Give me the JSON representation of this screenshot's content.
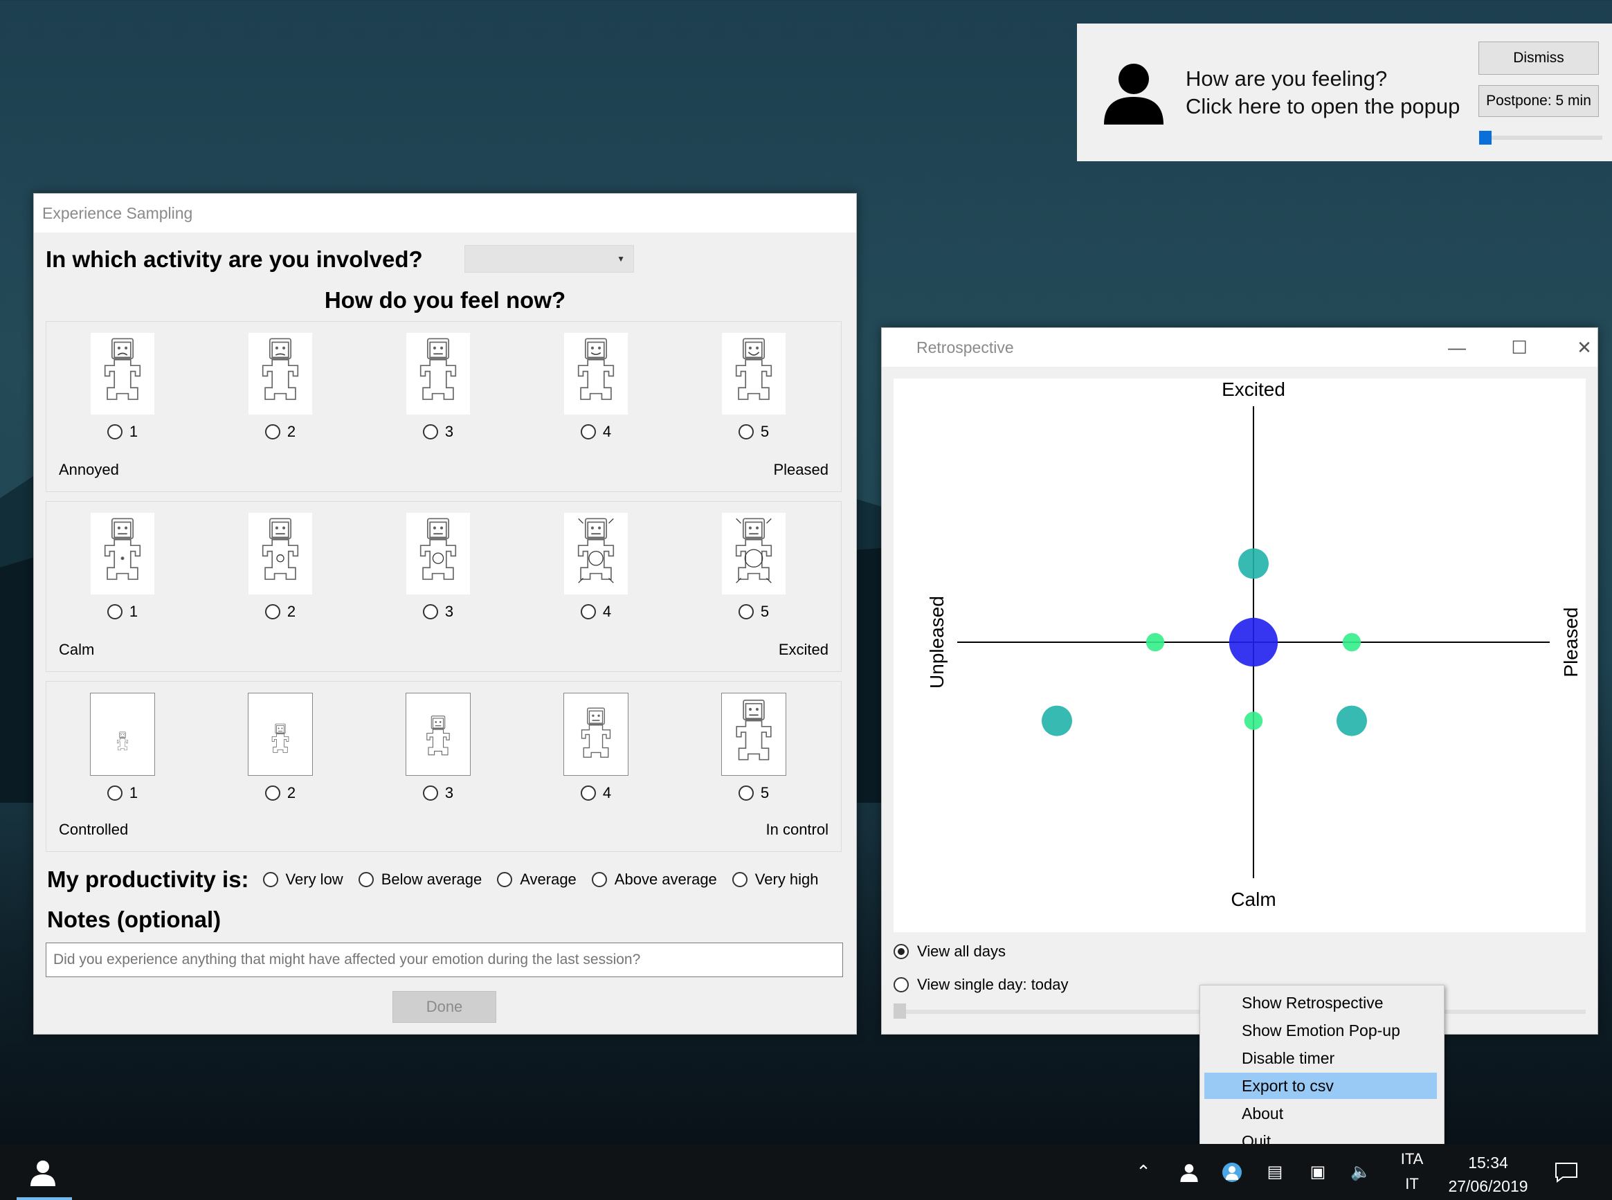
{
  "colors": {
    "accent": "#0a6fd8",
    "menu_highlight": "#99c9f5",
    "point_teal": "#20b2aa",
    "point_green": "#33ee88",
    "point_blue": "#2020ee"
  },
  "experience_window": {
    "title": "Experience Sampling",
    "activity_question": "In which activity are you involved?",
    "activity_value": "",
    "feel_question": "How do you feel now?",
    "scales": [
      {
        "options": [
          "1",
          "2",
          "3",
          "4",
          "5"
        ],
        "low": "Annoyed",
        "high": "Pleased",
        "icons": [
          "valence-1-icon",
          "valence-2-icon",
          "valence-3-icon",
          "valence-4-icon",
          "valence-5-icon"
        ]
      },
      {
        "options": [
          "1",
          "2",
          "3",
          "4",
          "5"
        ],
        "low": "Calm",
        "high": "Excited",
        "icons": [
          "arousal-1-icon",
          "arousal-2-icon",
          "arousal-3-icon",
          "arousal-4-icon",
          "arousal-5-icon"
        ]
      },
      {
        "options": [
          "1",
          "2",
          "3",
          "4",
          "5"
        ],
        "low": "Controlled",
        "high": "In control",
        "icons": [
          "dominance-1-icon",
          "dominance-2-icon",
          "dominance-3-icon",
          "dominance-4-icon",
          "dominance-5-icon"
        ]
      }
    ],
    "productivity_label": "My productivity is:",
    "productivity_options": [
      "Very low",
      "Below average",
      "Average",
      "Above average",
      "Very high"
    ],
    "notes_label": "Notes (optional)",
    "notes_placeholder": "Did you experience anything that might have affected your emotion during the last session?",
    "done_label": "Done"
  },
  "notification": {
    "line1": "How are you feeling?",
    "line2": "Click here to open the popup",
    "dismiss_label": "Dismiss",
    "postpone_label": "Postpone: 5 min",
    "icon": "user-icon"
  },
  "retrospective_window": {
    "title": "Retrospective",
    "controls": [
      "minimize-icon",
      "maximize-icon",
      "close-icon"
    ],
    "view_all_label": "View all days",
    "view_single_label": "View single day: today",
    "selected_view": "all"
  },
  "chart_data": {
    "type": "scatter",
    "axis_labels": {
      "top": "Excited",
      "bottom": "Calm",
      "left": "Unpleased",
      "right": "Pleased"
    },
    "xlim": [
      -3,
      3
    ],
    "ylim": [
      -3,
      3
    ],
    "grid": false,
    "points": [
      {
        "x": 0,
        "y": 1,
        "size": 1,
        "color": "teal"
      },
      {
        "x": -1,
        "y": 0,
        "size": 0.6,
        "color": "green"
      },
      {
        "x": 0,
        "y": 0,
        "size": 1.6,
        "color": "blue"
      },
      {
        "x": 1,
        "y": 0,
        "size": 0.6,
        "color": "green"
      },
      {
        "x": -2,
        "y": -1,
        "size": 1,
        "color": "teal"
      },
      {
        "x": 0,
        "y": -1,
        "size": 0.6,
        "color": "green"
      },
      {
        "x": 1,
        "y": -1,
        "size": 1,
        "color": "teal"
      }
    ]
  },
  "context_menu": {
    "items": [
      "Show Retrospective",
      "Show Emotion Pop-up",
      "Disable timer",
      "Export to csv",
      "About",
      "Quit"
    ],
    "highlighted": 3
  },
  "taskbar": {
    "language_top": "ITA",
    "language_bottom": "IT",
    "time": "15:34",
    "date": "27/06/2019"
  }
}
